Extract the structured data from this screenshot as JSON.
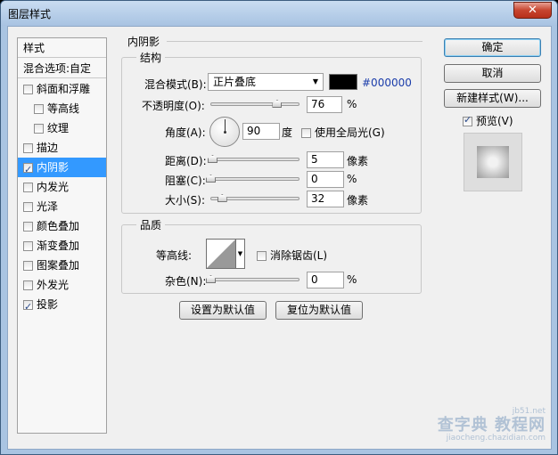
{
  "window": {
    "title": "图层样式",
    "close_glyph": "✕"
  },
  "stylelist": {
    "header": "样式",
    "blend_options": "混合选项:自定",
    "items": [
      {
        "label": "斜面和浮雕",
        "checked": false
      },
      {
        "label": "等高线",
        "checked": false
      },
      {
        "label": "纹理",
        "checked": false
      },
      {
        "label": "描边",
        "checked": false
      },
      {
        "label": "内阴影",
        "checked": true
      },
      {
        "label": "内发光",
        "checked": false
      },
      {
        "label": "光泽",
        "checked": false
      },
      {
        "label": "颜色叠加",
        "checked": false
      },
      {
        "label": "渐变叠加",
        "checked": false
      },
      {
        "label": "图案叠加",
        "checked": false
      },
      {
        "label": "外发光",
        "checked": false
      },
      {
        "label": "投影",
        "checked": true
      }
    ]
  },
  "inner_shadow": {
    "section_title": "内阴影",
    "structure": {
      "title": "结构",
      "blend_mode_label": "混合模式(B):",
      "blend_mode_value": "正片叠底",
      "color": "#000000",
      "color_text": "#000000",
      "opacity_label": "不透明度(O):",
      "opacity_value": "76",
      "opacity_unit": "%",
      "opacity_fraction": 0.76,
      "angle_label": "角度(A):",
      "angle_value": "90",
      "angle_unit": "度",
      "global_light_label": "使用全局光(G)",
      "global_light_checked": false,
      "distance_label": "距离(D):",
      "distance_value": "5",
      "distance_unit": "像素",
      "distance_fraction": 0.02,
      "choke_label": "阻塞(C):",
      "choke_value": "0",
      "choke_unit": "%",
      "choke_fraction": 0,
      "size_label": "大小(S):",
      "size_value": "32",
      "size_unit": "像素",
      "size_fraction": 0.13
    },
    "quality": {
      "title": "品质",
      "contour_label": "等高线:",
      "antialias_label": "消除锯齿(L)",
      "antialias_checked": false,
      "noise_label": "杂色(N):",
      "noise_value": "0",
      "noise_unit": "%",
      "noise_fraction": 0
    },
    "make_default": "设置为默认值",
    "reset_default": "复位为默认值"
  },
  "buttons": {
    "ok": "确定",
    "cancel": "取消",
    "new_style": "新建样式(W)...",
    "preview_label": "预览(V)",
    "preview_checked": true
  },
  "watermark": {
    "line1": "jb51.net",
    "line2": "查字典 教程网",
    "line3": "jiaocheng.chazidian.com"
  }
}
